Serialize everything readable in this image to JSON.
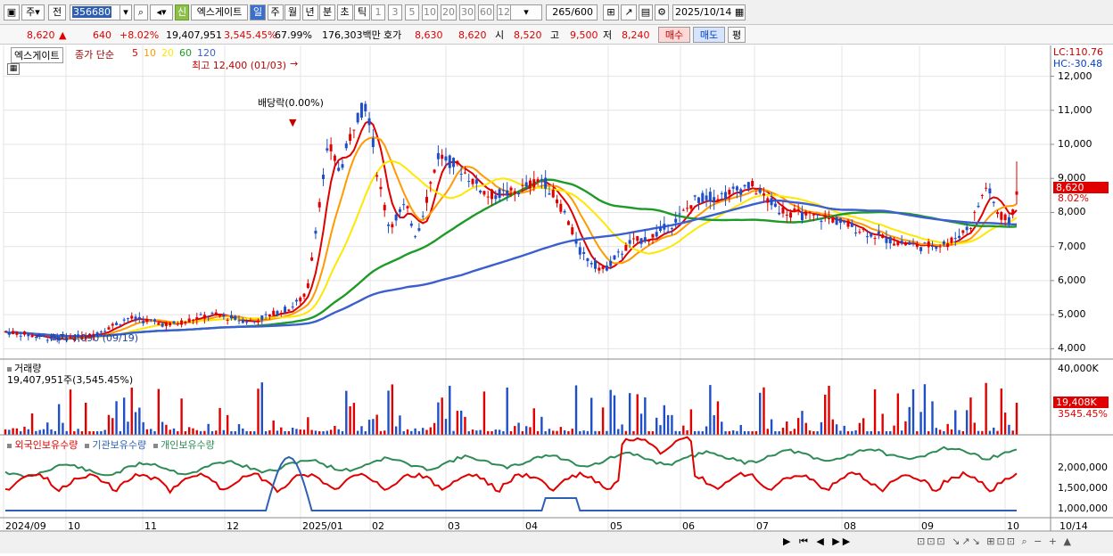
{
  "toolbar": {
    "market": "주",
    "type": "전",
    "code": "356680",
    "badge": "신",
    "name": "엑스게이트",
    "periods": [
      "일",
      "주",
      "월",
      "년",
      "분",
      "초",
      "틱"
    ],
    "active_period": "일",
    "nums": [
      "1",
      "3",
      "5",
      "10",
      "20",
      "30",
      "60",
      "120"
    ],
    "count": "265",
    "count_total": "/600",
    "date": "2025/10/14"
  },
  "info": {
    "price": "8,620",
    "arrow": "▲",
    "change": "640",
    "rate": "+8.02%",
    "volume": "19,407,951",
    "vol_rate": "3,545.45%",
    "turnover": "67.99%",
    "amount": "176,303백만",
    "quote_label": "호가",
    "quote1": "8,630",
    "quote2": "8,620",
    "open_label": "시",
    "open": "8,520",
    "high_label": "고",
    "high": "9,500",
    "low_label": "저",
    "low": "8,240",
    "buy": "매수",
    "sell": "매도",
    "eval": "평"
  },
  "legend": {
    "name": "엑스게이트",
    "ma_label": "종가 단순",
    "ma": [
      "5",
      "10",
      "20",
      "60",
      "120"
    ],
    "ma_colors": [
      "#e00000",
      "#ff9a00",
      "#ffe800",
      "#1e9a28",
      "#3c5fd0"
    ]
  },
  "annotations": {
    "high": "최고 12,400 (01/03)",
    "low": "최저 4,090 (09/19)",
    "dividend": "배당락(0.00%)"
  },
  "right_axis": {
    "lc": "LC:110.76",
    "hc": "HC:-30.48",
    "price_ticks": [
      "12,000",
      "11,000",
      "10,000",
      "9,000",
      "8,000",
      "7,000",
      "6,000",
      "5,000",
      "4,000"
    ],
    "current_price": "8,620",
    "current_rate": "8.02%",
    "vol_ticks": [
      "40,000K"
    ],
    "vol_current": "19,408K",
    "vol_rate": "3545.45%",
    "hold_ticks": [
      "2,000,000",
      "1,500,000",
      "1,000,000"
    ]
  },
  "volume_panel": {
    "title": "거래량",
    "value": "19,407,951주(3,545.45%)"
  },
  "holding_panel": {
    "foreign": "외국인보유수량",
    "inst": "기관보유수량",
    "individual": "개인보유수량"
  },
  "x_axis": {
    "labels": [
      "2024/09",
      "10",
      "11",
      "12",
      "2025/01",
      "02",
      "03",
      "04",
      "05",
      "06",
      "07",
      "08",
      "09",
      "10"
    ],
    "end_label": "10/14"
  },
  "chart_data": {
    "type": "candlestick",
    "price_range": [
      3800,
      12800
    ],
    "ma_periods": [
      5,
      10,
      20,
      60,
      120
    ]
  }
}
